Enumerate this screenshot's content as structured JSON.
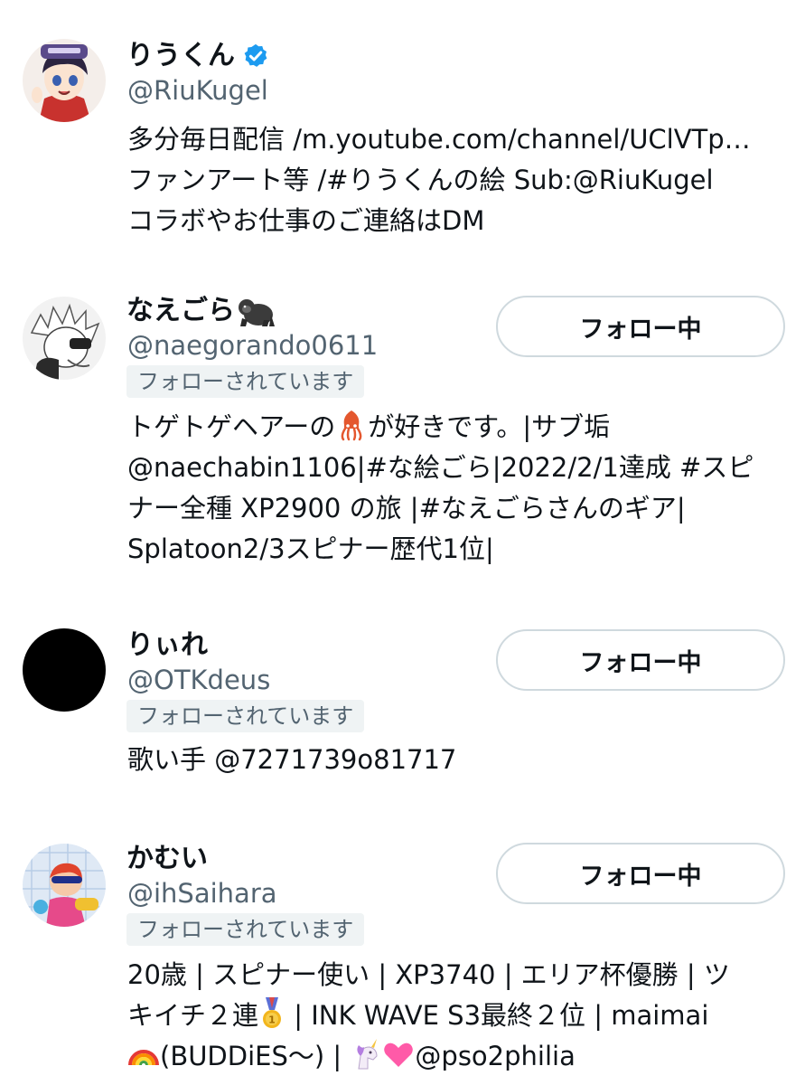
{
  "users": [
    {
      "name": "りうくん",
      "verified": true,
      "handle": "@RiuKugel",
      "follows_you": null,
      "following_button": null,
      "bio": [
        "多分毎日配信 /m.youtube.com/channel/UClVTp…",
        "ファンアート等 /#りうくんの絵 Sub:@RiuKugel",
        "コラボやお仕事のご連絡はDM"
      ]
    },
    {
      "name": "なえごら",
      "name_emoji": "gorilla-emoji",
      "handle": "@naegorando0611",
      "follows_you": "フォローされています",
      "following_button": "フォロー中",
      "bio": [
        {
          "before": "トゲトゲヘアーの",
          "emoji": "squid-emoji",
          "after": "が好きです。|サブ垢"
        },
        "@naechabin1106|#な絵ごら|2022/2/1達成 #スピ",
        "ナー全種 XP2900 の旅 |#なえごらさんのギア|",
        "Splatoon2/3スピナー歴代1位|"
      ]
    },
    {
      "name": "りぃれ",
      "handle": "@OTKdeus",
      "follows_you": "フォローされています",
      "following_button": "フォロー中",
      "bio": [
        "歌い手 @7271739o81717"
      ]
    },
    {
      "name": "かむい",
      "handle": "@ihSaihara",
      "follows_you": "フォローされています",
      "following_button": "フォロー中",
      "bio": [
        "20歳 | スピナー使い | XP3740 | エリア杯優勝 | ツ",
        {
          "before": "キイチ２連",
          "emoji": "medal-emoji",
          "after": " | INK WAVE S3最終２位 | maimai"
        },
        {
          "emoji": "rainbow-emoji",
          "after": "(BUDDiES～) | ",
          "emoji2": "unicorn-emoji",
          "emoji3": "pink-heart-emoji",
          "after2": "@pso2philia"
        }
      ]
    }
  ],
  "colors": {
    "text": "#0f1419",
    "secondary": "#536471",
    "badge_bg": "#eff3f4",
    "button_border": "#cfd9de",
    "verified": "#1d9bf0"
  }
}
